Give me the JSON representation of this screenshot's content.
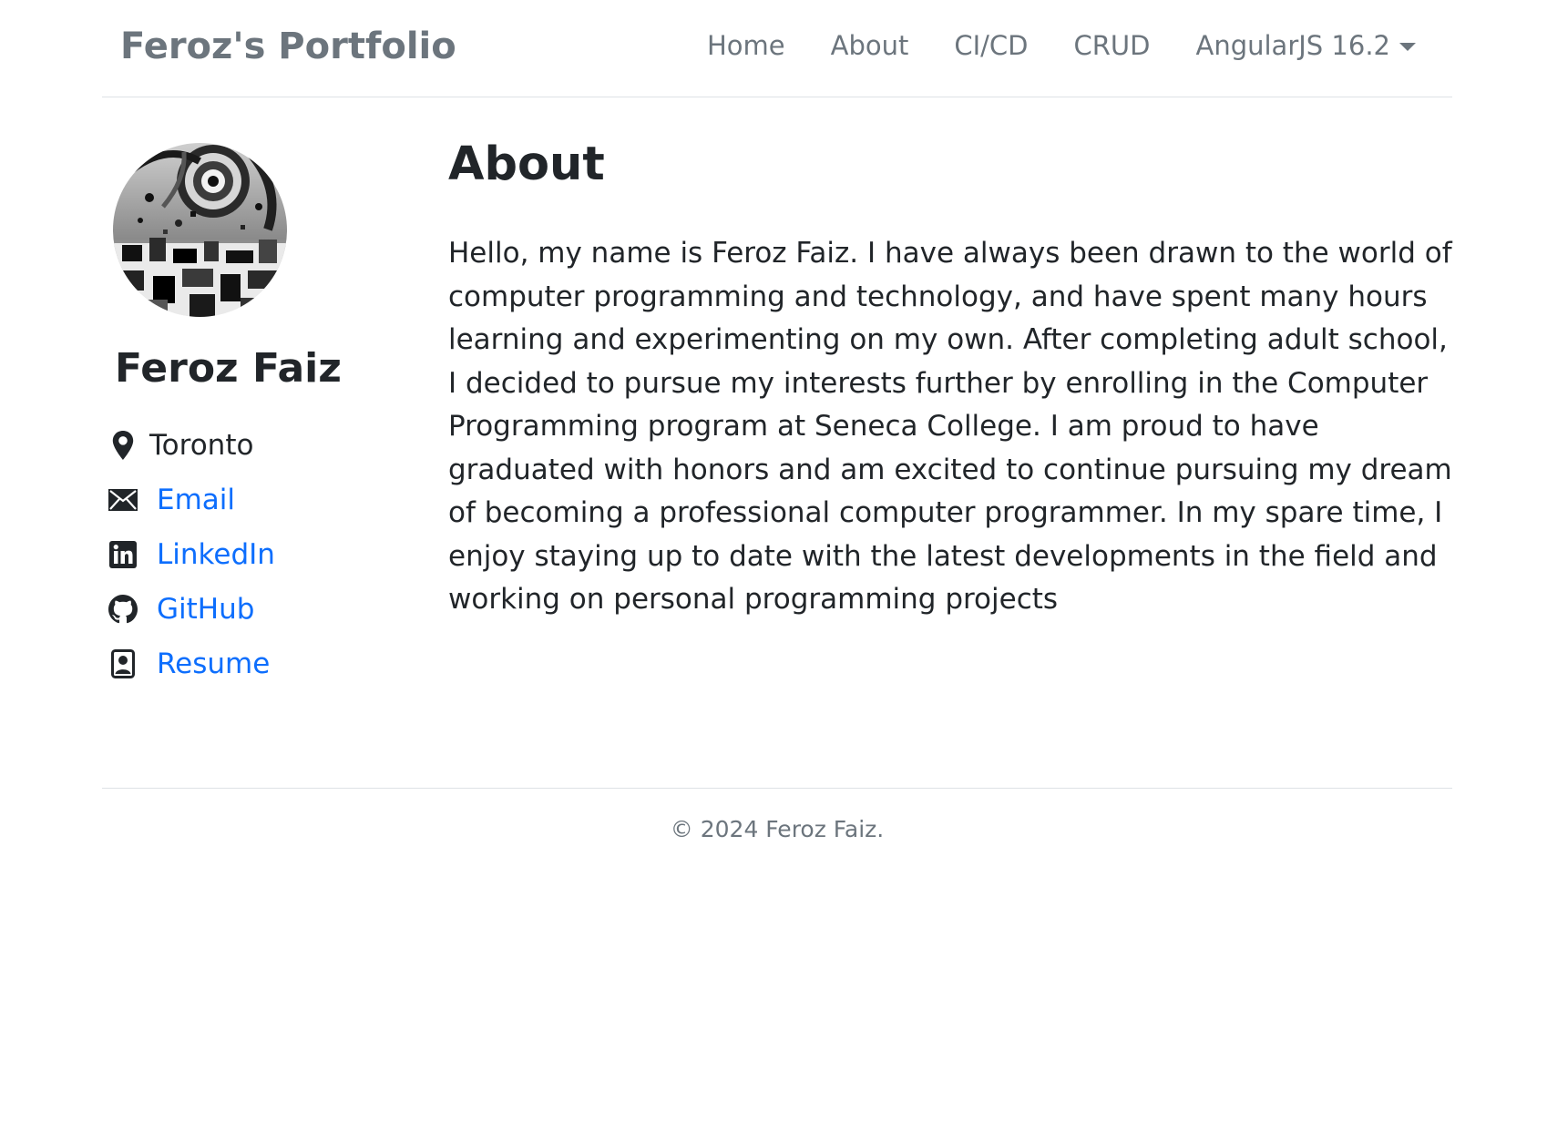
{
  "navbar": {
    "brand": "Feroz's Portfolio",
    "links": [
      {
        "label": "Home"
      },
      {
        "label": "About"
      },
      {
        "label": "CI/CD"
      },
      {
        "label": "CRUD"
      },
      {
        "label": "AngularJS 16.2"
      }
    ]
  },
  "sidebar": {
    "avatar_icon": "abstract-portrait-image",
    "name": "Feroz Faiz",
    "location": "Toronto",
    "links": [
      {
        "label": "Email",
        "icon": "envelope-icon"
      },
      {
        "label": "LinkedIn",
        "icon": "linkedin-icon"
      },
      {
        "label": "GitHub",
        "icon": "github-icon"
      },
      {
        "label": "Resume",
        "icon": "person-badge-icon"
      }
    ]
  },
  "main": {
    "title": "About",
    "paragraph": "Hello, my name is Feroz Faiz. I have always been drawn to the world of computer programming and technology, and have spent many hours learning and experimenting on my own. After completing adult school, I decided to pursue my interests further by enrolling in the Computer Programming program at Seneca College. I am proud to have graduated with honors and am excited to continue pursuing my dream of becoming a professional computer programmer. In my spare time, I enjoy staying up to date with the latest developments in the field and working on personal programming projects"
  },
  "footer": {
    "copyright": "© 2024 Feroz Faiz."
  },
  "colors": {
    "link": "#0d6efd",
    "muted": "#6c757d",
    "text": "#212529",
    "border": "#dee2e6"
  }
}
